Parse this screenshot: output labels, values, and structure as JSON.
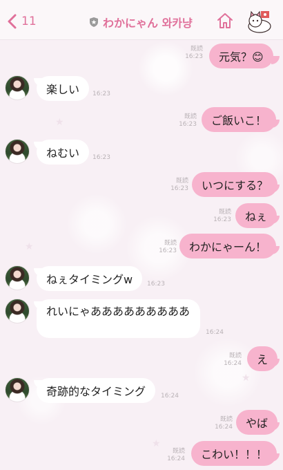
{
  "header": {
    "back_count": "11",
    "title": "わかにゃん 와카냥"
  },
  "messages": [
    {
      "side": "out",
      "text": "元気？😊",
      "read": "既読",
      "time": "16:23"
    },
    {
      "side": "in",
      "text": "楽しい",
      "time": "16:23"
    },
    {
      "side": "out",
      "text": "ご飯いこ！",
      "read": "既読",
      "time": "16:23"
    },
    {
      "side": "in",
      "text": "ねむい",
      "time": "16:23"
    },
    {
      "side": "out",
      "text": "いつにする？",
      "read": "既読",
      "time": "16:23"
    },
    {
      "side": "out",
      "text": "ねぇ",
      "read": "既読",
      "time": "16:23"
    },
    {
      "side": "out",
      "text": "わかにゃーん！",
      "read": "既読",
      "time": "16:23"
    },
    {
      "side": "in",
      "text": "ねぇタイミングw",
      "time": "16:23"
    },
    {
      "side": "in",
      "text": "れいにゃあああああああああ",
      "time": "16:24"
    },
    {
      "side": "out",
      "text": "え",
      "read": "既読",
      "time": "16:24"
    },
    {
      "side": "in",
      "text": "奇跡的なタイミング",
      "time": "16:24"
    },
    {
      "side": "out",
      "text": "やば",
      "read": "既読",
      "time": "16:24"
    },
    {
      "side": "out",
      "text": "こわい！！！",
      "read": "既読",
      "time": "16:24"
    }
  ]
}
